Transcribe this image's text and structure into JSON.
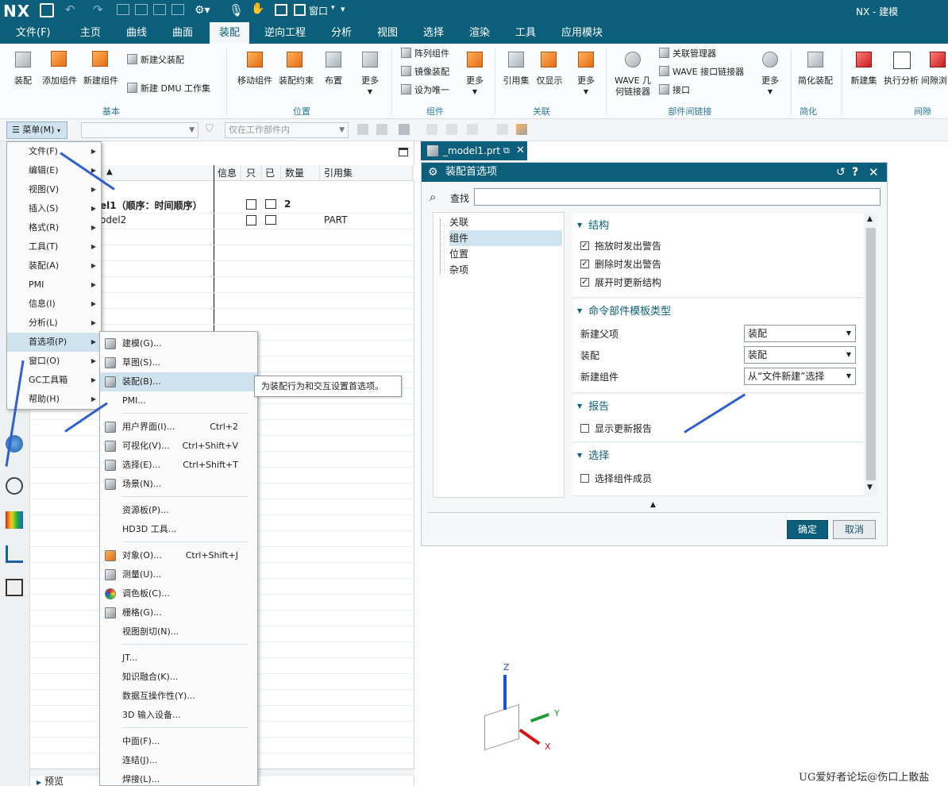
{
  "app": {
    "logo": "NX",
    "title": "NX - 建模",
    "window_menu": "窗口"
  },
  "menubar": {
    "tabs": [
      "文件(F)",
      "主页",
      "曲线",
      "曲面",
      "装配",
      "逆向工程",
      "分析",
      "视图",
      "选择",
      "渲染",
      "工具",
      "应用模块"
    ],
    "active": "装配"
  },
  "ribbon": {
    "basic": {
      "group": "基本",
      "assemble": "装配",
      "add_component": "添加组件",
      "new_component": "新建组件",
      "new_parent": "新建父装配",
      "new_dmu": "新建 DMU 工作集"
    },
    "position": {
      "group": "位置",
      "move_component": "移动组件",
      "assembly_constraint": "装配约束",
      "layout": "布置",
      "more": "更多"
    },
    "component": {
      "group": "组件",
      "array": "阵列组件",
      "mirror": "镜像装配",
      "make_unique": "设为唯一",
      "more": "更多"
    },
    "relation": {
      "group": "关联",
      "reference_set": "引用集",
      "show_only": "仅显示",
      "more": "更多"
    },
    "interpart": {
      "group": "部件间链接",
      "wave": "WAVE 几何链接器",
      "relation_manager": "关联管理器",
      "wave_interface": "WAVE 接口链接器",
      "interface": "接口",
      "more": "更多"
    },
    "simplify": {
      "group": "简化",
      "simplify_assembly": "简化装配"
    },
    "clearance": {
      "group": "间隙",
      "new_set": "新建集",
      "run_analysis": "执行分析",
      "clearance_browser": "间隙浏"
    }
  },
  "toolbar2": {
    "menu_button": "菜单(M)",
    "filter_placeholder": "仅在工作部件内"
  },
  "navigator": {
    "columns": [
      "信息",
      "只",
      "已",
      "数量",
      "引用集"
    ],
    "rows": [
      {
        "name": "el1（顺序：时间顺序）",
        "qty": "2",
        "refset": ""
      },
      {
        "name": "odel2",
        "qty": "",
        "refset": "PART"
      }
    ],
    "footer": "预览"
  },
  "main_menu": {
    "items": [
      "文件(F)",
      "编辑(E)",
      "视图(V)",
      "插入(S)",
      "格式(R)",
      "工具(T)",
      "装配(A)",
      "PMI",
      "信息(I)",
      "分析(L)",
      "首选项(P)",
      "窗口(O)",
      "GC工具箱",
      "帮助(H)"
    ],
    "highlight": "首选项(P)"
  },
  "pref_menu": {
    "items": [
      {
        "label": "建模(G)...",
        "shortcut": ""
      },
      {
        "label": "草图(S)...",
        "shortcut": ""
      },
      {
        "label": "装配(B)...",
        "shortcut": ""
      },
      {
        "label": "PMI...",
        "shortcut": ""
      },
      {
        "label": "用户界面(I)...",
        "shortcut": "Ctrl+2"
      },
      {
        "label": "可视化(V)...",
        "shortcut": "Ctrl+Shift+V"
      },
      {
        "label": "选择(E)...",
        "shortcut": "Ctrl+Shift+T"
      },
      {
        "label": "场景(N)...",
        "shortcut": ""
      },
      {
        "label": "资源板(P)...",
        "shortcut": ""
      },
      {
        "label": "HD3D 工具...",
        "shortcut": ""
      },
      {
        "label": "对象(O)...",
        "shortcut": "Ctrl+Shift+J"
      },
      {
        "label": "测量(U)...",
        "shortcut": ""
      },
      {
        "label": "调色板(C)...",
        "shortcut": ""
      },
      {
        "label": "栅格(G)...",
        "shortcut": ""
      },
      {
        "label": "视图剖切(N)...",
        "shortcut": ""
      },
      {
        "label": "JT...",
        "shortcut": ""
      },
      {
        "label": "知识融合(K)...",
        "shortcut": ""
      },
      {
        "label": "数据互操作性(Y)...",
        "shortcut": ""
      },
      {
        "label": "3D 输入设备...",
        "shortcut": ""
      },
      {
        "label": "中面(F)...",
        "shortcut": ""
      },
      {
        "label": "连结(J)...",
        "shortcut": ""
      },
      {
        "label": "焊接(L)...",
        "shortcut": ""
      }
    ],
    "highlight": "装配(B)...",
    "tooltip": "为装配行为和交互设置首选项。"
  },
  "doc_tab": {
    "label": "_model1.prt"
  },
  "dialog": {
    "title": "装配首选项",
    "find_label": "查找",
    "find_value": "",
    "tree": [
      "关联",
      "组件",
      "位置",
      "杂项"
    ],
    "tree_selected": "组件",
    "structure": {
      "title": "结构",
      "options": [
        {
          "label": "拖放时发出警告",
          "checked": true
        },
        {
          "label": "删除时发出警告",
          "checked": true
        },
        {
          "label": "展开时更新结构",
          "checked": true
        }
      ]
    },
    "template": {
      "title": "命令部件模板类型",
      "rows": [
        {
          "label": "新建父项",
          "value": "装配"
        },
        {
          "label": "装配",
          "value": "装配"
        },
        {
          "label": "新建组件",
          "value": "从“文件新建”选择"
        }
      ]
    },
    "report": {
      "title": "报告",
      "options": [
        {
          "label": "显示更新报告",
          "checked": false
        }
      ]
    },
    "selection": {
      "title": "选择",
      "options": [
        {
          "label": "选择组件成员",
          "checked": false
        }
      ]
    },
    "ok": "确定",
    "cancel": "取消"
  },
  "triad": {
    "x": "X",
    "y": "Y",
    "z": "Z"
  },
  "watermark": "UG爱好者论坛@伤口上散盐",
  "colors": {
    "brand": "#0b5f7a",
    "annotation_arrow": "#2f5fd1"
  }
}
